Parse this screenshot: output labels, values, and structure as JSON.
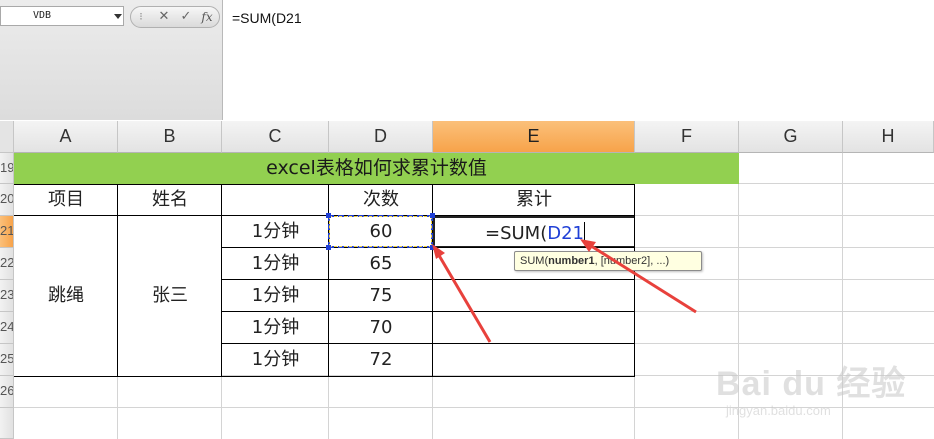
{
  "formula_bar": {
    "name_box": "VDB",
    "buttons": {
      "cancel": "✕",
      "enter": "✓",
      "fx": "fx"
    },
    "formula": "=SUM(D21"
  },
  "columns": [
    "A",
    "B",
    "C",
    "D",
    "E",
    "F",
    "G",
    "H"
  ],
  "active_column": "E",
  "rows": [
    "19",
    "20",
    "21",
    "22",
    "23",
    "24",
    "25",
    "26"
  ],
  "active_row": "21",
  "sheet": {
    "banner_title": "excel表格如何求累计数值",
    "headers": {
      "item": "项目",
      "name": "姓名",
      "count": "次数",
      "cumulative": "累计"
    },
    "item": "跳绳",
    "person": "张三",
    "records": [
      {
        "duration": "1分钟",
        "count": "60"
      },
      {
        "duration": "1分钟",
        "count": "65"
      },
      {
        "duration": "1分钟",
        "count": "75"
      },
      {
        "duration": "1分钟",
        "count": "70"
      },
      {
        "duration": "1分钟",
        "count": "72"
      }
    ],
    "editing_cell": {
      "prefix": "=SUM(",
      "ref": "D21"
    }
  },
  "tooltip": {
    "fn": "SUM(",
    "arg1": "number1",
    "rest": ", [number2], ...)"
  },
  "watermark": {
    "main": "Bai du 经验",
    "sub": "jingyan.baidu.com"
  },
  "colors": {
    "banner": "#92d050",
    "active_header": "#f7a34a",
    "reference": "#1f3fd6",
    "arrow": "#e8413c"
  }
}
